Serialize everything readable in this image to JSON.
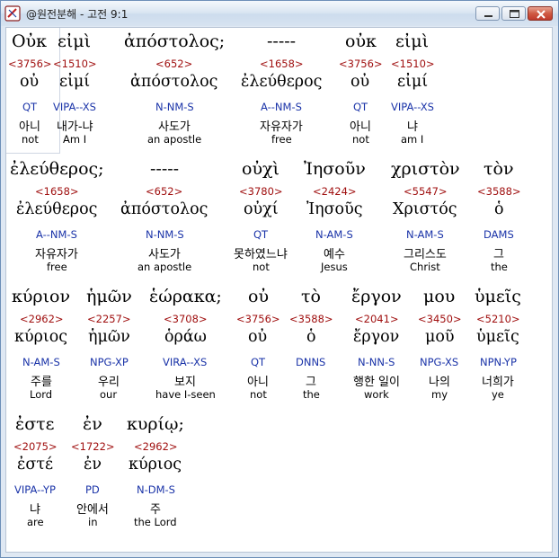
{
  "window": {
    "title": "@원전분해 - 고전 9:1"
  },
  "verse": [
    {
      "greek": "Οὐκ",
      "strong": "<3756>",
      "lemma": "οὐ",
      "parsing": "QT",
      "korean": "아니",
      "english": "not"
    },
    {
      "greek": "εἰμὶ",
      "strong": "<1510>",
      "lemma": "εἰμί",
      "parsing": "VIPA--XS",
      "korean": "내가-냐",
      "english": "Am I"
    },
    {
      "greek": "ἀπόστολος;",
      "strong": "<652>",
      "lemma": "ἀπόστολος",
      "parsing": "N-NM-S",
      "korean": "사도가",
      "english": "an apostle"
    },
    {
      "greek": "-----",
      "strong": "<1658>",
      "lemma": "ἐλεύθερος",
      "parsing": "A--NM-S",
      "korean": "자유자가",
      "english": "free"
    },
    {
      "greek": "οὐκ",
      "strong": "<3756>",
      "lemma": "οὐ",
      "parsing": "QT",
      "korean": "아니",
      "english": "not"
    },
    {
      "greek": "εἰμὶ",
      "strong": "<1510>",
      "lemma": "εἰμί",
      "parsing": "VIPA--XS",
      "korean": "냐",
      "english": "am I"
    },
    {
      "greek": "ἐλεύθερος;",
      "strong": "<1658>",
      "lemma": "ἐλεύθερος",
      "parsing": "A--NM-S",
      "korean": "자유자가",
      "english": "free"
    },
    {
      "greek": "-----",
      "strong": "<652>",
      "lemma": "ἀπόστολος",
      "parsing": "N-NM-S",
      "korean": "사도가",
      "english": "an apostle"
    },
    {
      "greek": "οὐχὶ",
      "strong": "<3780>",
      "lemma": "οὐχί",
      "parsing": "QT",
      "korean": "못하였느냐",
      "english": "not"
    },
    {
      "greek": "Ἰησοῦν",
      "strong": "<2424>",
      "lemma": "Ἰησοῦς",
      "parsing": "N-AM-S",
      "korean": "예수",
      "english": "Jesus"
    },
    {
      "greek": "χριστὸν",
      "strong": "<5547>",
      "lemma": "Χριστός",
      "parsing": "N-AM-S",
      "korean": "그리스도",
      "english": "Christ"
    },
    {
      "greek": "τὸν",
      "strong": "<3588>",
      "lemma": "ὁ",
      "parsing": "DAMS",
      "korean": "그",
      "english": "the"
    },
    {
      "greek": "κύριον",
      "strong": "<2962>",
      "lemma": "κύριος",
      "parsing": "N-AM-S",
      "korean": "주를",
      "english": "Lord"
    },
    {
      "greek": "ἡμῶν",
      "strong": "<2257>",
      "lemma": "ἡμῶν",
      "parsing": "NPG-XP",
      "korean": "우리",
      "english": "our"
    },
    {
      "greek": "ἑώρακα;",
      "strong": "<3708>",
      "lemma": "ὁράω",
      "parsing": "VIRA--XS",
      "korean": "보지",
      "english": "have I-seen"
    },
    {
      "greek": "οὐ",
      "strong": "<3756>",
      "lemma": "οὐ",
      "parsing": "QT",
      "korean": "아니",
      "english": "not"
    },
    {
      "greek": "τὸ",
      "strong": "<3588>",
      "lemma": "ὁ",
      "parsing": "DNNS",
      "korean": "그",
      "english": "the"
    },
    {
      "greek": "ἔργον",
      "strong": "<2041>",
      "lemma": "ἔργον",
      "parsing": "N-NN-S",
      "korean": "행한 일이",
      "english": "work"
    },
    {
      "greek": "μου",
      "strong": "<3450>",
      "lemma": "μοῦ",
      "parsing": "NPG-XS",
      "korean": "나의",
      "english": "my"
    },
    {
      "greek": "ὑμεῖς",
      "strong": "<5210>",
      "lemma": "ὑμεῖς",
      "parsing": "NPN-YP",
      "korean": "너희가",
      "english": "ye"
    },
    {
      "greek": "ἐστε",
      "strong": "<2075>",
      "lemma": "ἐστέ",
      "parsing": "VIPA--YP",
      "korean": "냐",
      "english": "are"
    },
    {
      "greek": "ἐν",
      "strong": "<1722>",
      "lemma": "ἐν",
      "parsing": "PD",
      "korean": "안에서",
      "english": "in"
    },
    {
      "greek": "κυρίῳ;",
      "strong": "<2962>",
      "lemma": "κύριος",
      "parsing": "N-DM-S",
      "korean": "주",
      "english": "the Lord"
    }
  ]
}
